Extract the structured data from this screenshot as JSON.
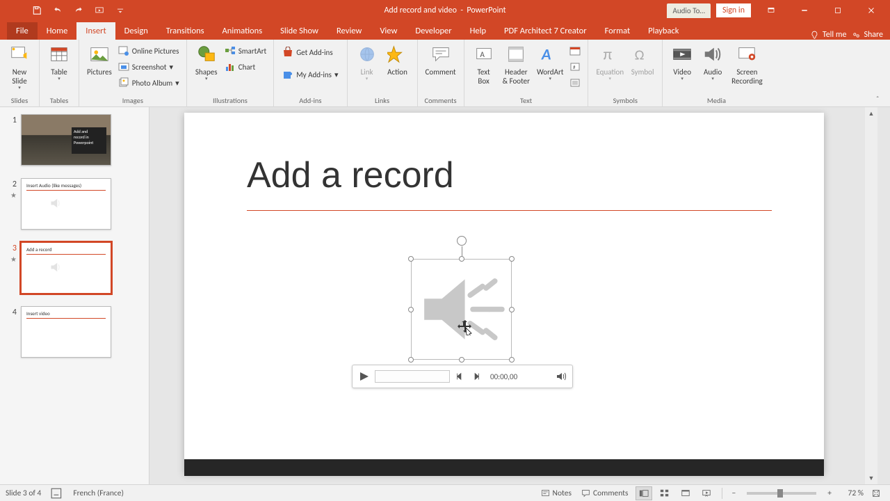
{
  "titlebar": {
    "doc_title": "Add record and video",
    "app_name": "PowerPoint",
    "context_tool": "Audio To…",
    "sign_in": "Sign in"
  },
  "tabs": {
    "file": "File",
    "items": [
      "Home",
      "Insert",
      "Design",
      "Transitions",
      "Animations",
      "Slide Show",
      "Review",
      "View",
      "Developer",
      "Help",
      "PDF Architect 7 Creator",
      "Format",
      "Playback"
    ],
    "active": "Insert",
    "tell_me": "Tell me",
    "share": "Share"
  },
  "ribbon": {
    "slides": {
      "group": "Slides",
      "new_slide": "New\nSlide"
    },
    "tables": {
      "group": "Tables",
      "table": "Table"
    },
    "images": {
      "group": "Images",
      "pictures": "Pictures",
      "online_pictures": "Online Pictures",
      "screenshot": "Screenshot",
      "photo_album": "Photo Album"
    },
    "illustrations": {
      "group": "Illustrations",
      "shapes": "Shapes",
      "smartart": "SmartArt",
      "chart": "Chart"
    },
    "addins": {
      "group": "Add-ins",
      "get": "Get Add-ins",
      "my": "My Add-ins"
    },
    "links": {
      "group": "Links",
      "link": "Link",
      "action": "Action"
    },
    "comments": {
      "group": "Comments",
      "comment": "Comment"
    },
    "text": {
      "group": "Text",
      "text_box": "Text\nBox",
      "header_footer": "Header\n& Footer",
      "wordart": "WordArt"
    },
    "symbols": {
      "group": "Symbols",
      "equation": "Equation",
      "symbol": "Symbol"
    },
    "media": {
      "group": "Media",
      "video": "Video",
      "audio": "Audio",
      "screen_recording": "Screen\nRecording"
    }
  },
  "slides_panel": {
    "items": [
      {
        "num": "1",
        "title_a": "Add and",
        "title_b": "record in",
        "title_c": "Powerpoint"
      },
      {
        "num": "2",
        "title": "Insert Audio (like messages)",
        "has_audio": true
      },
      {
        "num": "3",
        "title": "Add a record",
        "has_audio": true,
        "selected": true
      },
      {
        "num": "4",
        "title": "Insert video"
      }
    ]
  },
  "slide": {
    "title": "Add a record",
    "player_time": "00:00,00"
  },
  "status": {
    "slide_pos": "Slide 3 of 4",
    "language": "French (France)",
    "notes": "Notes",
    "comments": "Comments",
    "zoom": "72 %"
  }
}
